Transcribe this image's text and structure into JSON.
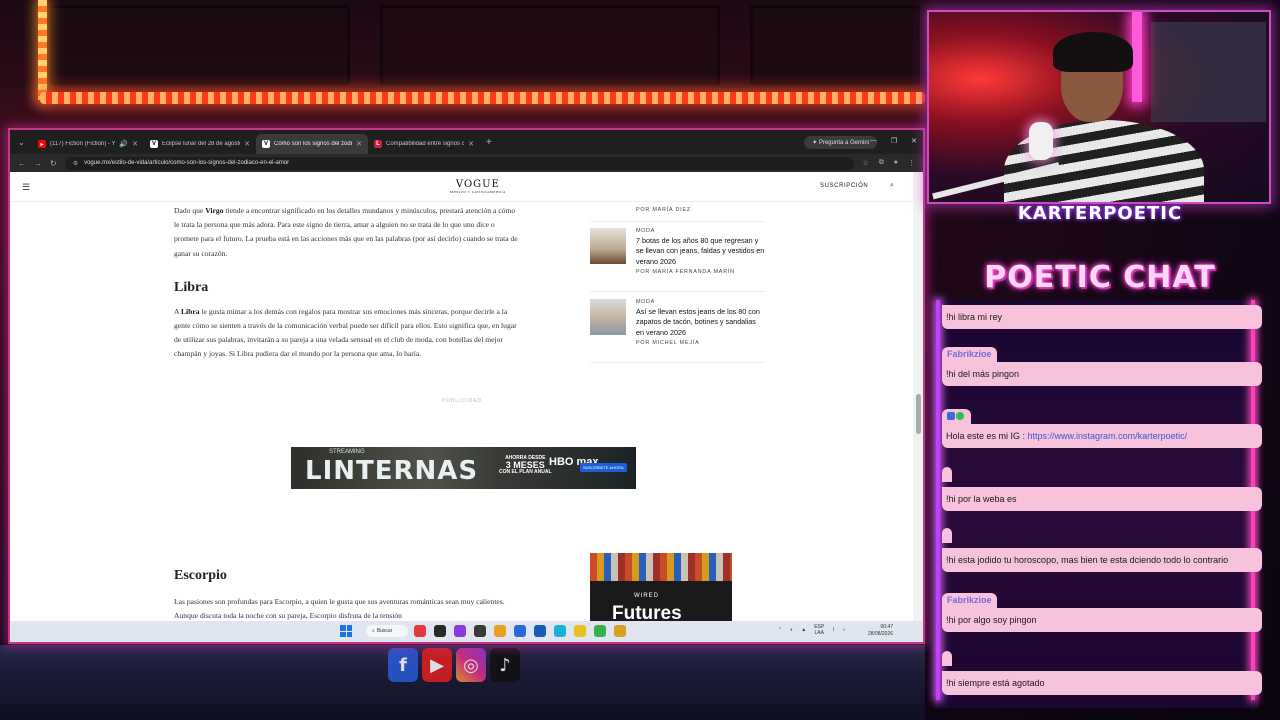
{
  "browser": {
    "tabs": [
      {
        "title": "(117) Fiction (Fiction) - YouT",
        "favicon_color": "#ff0000"
      },
      {
        "title": "Eclipse lunar del 28 de agosto de",
        "favicon_color": "#ffffff"
      },
      {
        "title": "Cómo son los signos del zodiac",
        "favicon_color": "#ffffff",
        "active": true
      },
      {
        "title": "Compatibilidad entre signos del",
        "favicon_color": "#d02040"
      }
    ],
    "gemini_label": "Pregunta a Gemini",
    "url": "vogue.mx/estilo-de-vida/articulo/como-son-los-signos-del-zodiaco-en-el-amor"
  },
  "vogue": {
    "logo": "VOGUE",
    "logo_sub": "MÉXICO Y LATINOAMÉRICA",
    "subscribe": "SUSCRIPCIÓN"
  },
  "article": {
    "virgo_para": {
      "pre": "Dado que ",
      "bold": "Virgo",
      "post": " tiende a encontrar significado en los detalles mundanos y minúsculos, prestará atención a cómo le trata la persona que más adora. Para este signo de tierra, amar a alguien no se trata de lo que uno dice o promete para el futuro. La prueba está en las acciones más que en las palabras (por así decirlo) cuando se trata de ganar su corazón."
    },
    "libra_heading": "Libra",
    "libra_para": {
      "pre": "A ",
      "bold": "Libra",
      "post": " le gusta mimar a los demás con regalos para mostrar sus emociones más sinceras, porque decirle a la gente cómo se sienten a través de la comunicación verbal puede ser difícil para ellos. Esto significa que, en lugar de utilizar sus palabras, invitarán a su pareja a una velada sensual en el club de moda, con botellas del mejor champán y joyas. Si Libra pudiera dar el mundo por la persona que ama, lo haría."
    },
    "publicidad": "PUBLICIDAD",
    "escorpio_heading": "Escorpio",
    "escorpio_para": "Las pasiones son profundas para Escorpio, a quien le gusta que sus aventuras románticas sean muy calientes. Aunque discuta toda la noche con su pareja, Escorpio disfruta de la tensión"
  },
  "ad": {
    "network": "STREAMING",
    "title": "LINTERNAS",
    "offer_line1": "AHORRA DESDE",
    "offer_big": "3 MESES",
    "offer_line2": "CON EL PLAN ANUAL",
    "brand": "HBO max",
    "cta": "SUSCRÍBETE AHORA"
  },
  "sidebar": {
    "byline_top": "POR MARÍA DIEZ",
    "items": [
      {
        "category": "MODA",
        "title": "7 botas de los años 80 que regresan y se llevan con jeans, faldas y vestidos en verano 2026",
        "byline": "POR MARÍA FERNANDA MARÍN"
      },
      {
        "category": "MODA",
        "title": "Así se llevan estos jeans de los 80 con zapatos de tacón, botines y sandalias en verano 2026",
        "byline": "POR MICHEL MEJÍA"
      }
    ],
    "promo_brand": "WIRED",
    "promo_title": "Futures"
  },
  "taskbar": {
    "search": "Buscar",
    "lang": "ESP",
    "lang2": "LAA",
    "time": "00:47",
    "date": "28/08/2026"
  },
  "stream": {
    "streamer_name": "KARTERPOETIC",
    "chat_title": "POETIC CHAT",
    "messages": [
      {
        "user": "",
        "text": "!hi libra mi rey",
        "style": "none"
      },
      {
        "user": "Fabrikzioe",
        "text": "!hi del más pingon",
        "style": "blue"
      },
      {
        "user": "",
        "text": "Hola este es mi IG : ",
        "link": "https://www.instagram.com/karterpoetic/",
        "style": "green"
      },
      {
        "user": "",
        "text": "!hi por la weba es",
        "style": "faded"
      },
      {
        "user": "",
        "text": "!hi esta jodido tu horoscopo, mas bien te esta dciendo todo lo contrario",
        "style": "faded"
      },
      {
        "user": "Fabrikzioe",
        "text": "!hi por algo soy pingon",
        "style": "blue"
      },
      {
        "user": "",
        "text": "!hi siempre está agotado",
        "style": "faded"
      }
    ]
  }
}
